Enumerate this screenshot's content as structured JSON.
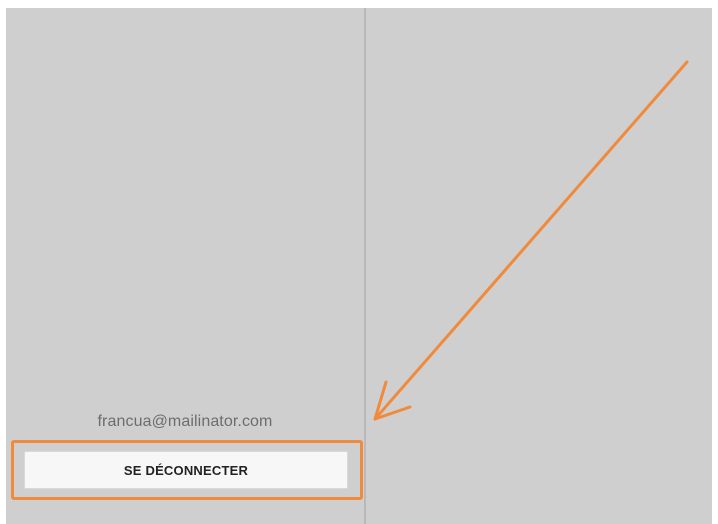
{
  "account": {
    "email": "francua@mailinator.com"
  },
  "actions": {
    "logout_label": "SE DÉCONNECTER"
  },
  "annotation": {
    "color": "#f08a3c",
    "arrow_icon": "arrow-pointer-icon",
    "highlight_icon": "highlight-box"
  },
  "colors": {
    "pane_background": "#cfcfcf",
    "divider": "#b9b9b9",
    "button_background": "#f7f7f7"
  }
}
